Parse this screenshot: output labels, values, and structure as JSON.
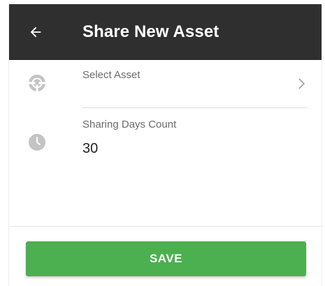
{
  "header": {
    "title": "Share New Asset",
    "back_icon": "arrow-left-icon"
  },
  "form": {
    "asset": {
      "label": "Select Asset",
      "icon": "steering-wheel-icon",
      "trailing_icon": "chevron-right-icon"
    },
    "sharing_days": {
      "label": "Sharing Days Count",
      "value": "30",
      "icon": "clock-icon"
    }
  },
  "actions": {
    "save_label": "SAVE"
  },
  "colors": {
    "appbar": "#2f2f2f",
    "save_button": "#4caf50",
    "icon_gray": "#c4c4c4"
  }
}
